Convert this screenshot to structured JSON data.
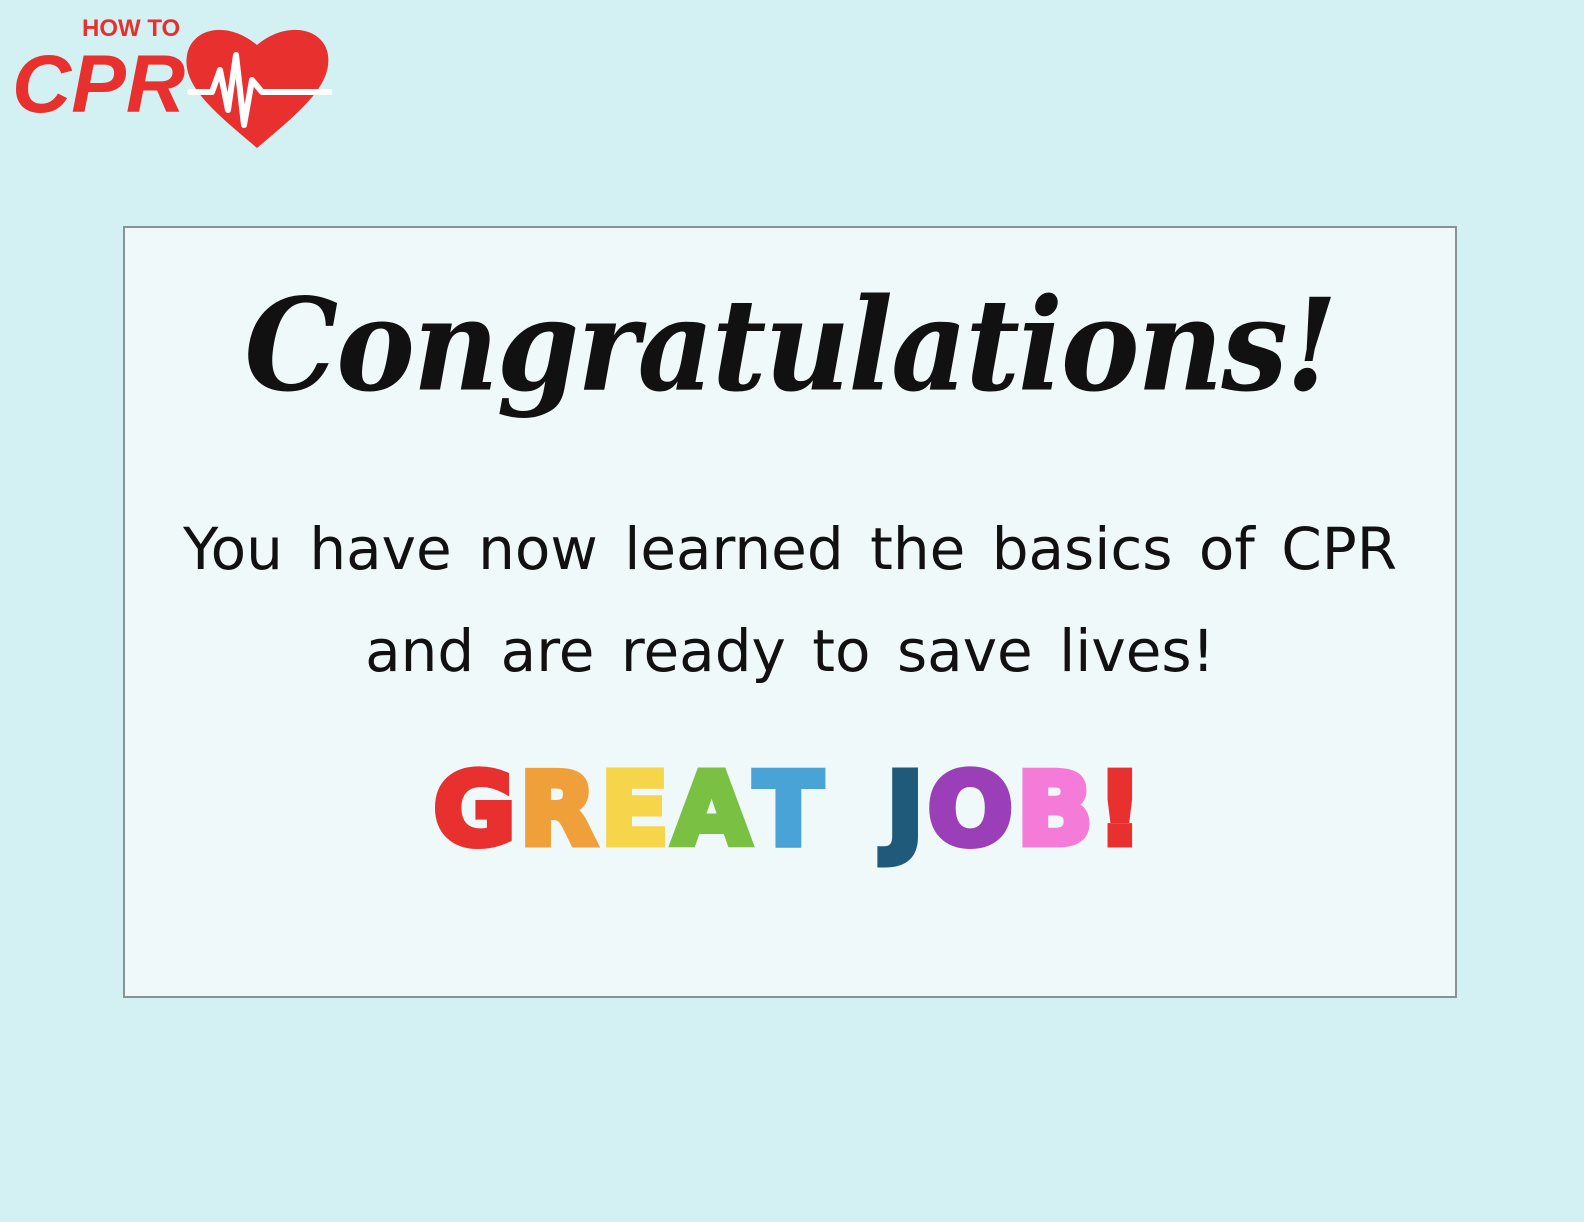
{
  "logo": {
    "small_text": "HOW TO",
    "big_text": "CPR",
    "icon": "heart-heartbeat-icon",
    "color": "#e8312f"
  },
  "card": {
    "heading": "Congratulations!",
    "message_line1": "You have now learned the basics of CPR",
    "message_line2": "and are ready to save lives!",
    "great_job": [
      {
        "char": "G",
        "color": "#e8312f"
      },
      {
        "char": "R",
        "color": "#f0a03a"
      },
      {
        "char": "E",
        "color": "#f7d54a"
      },
      {
        "char": "A",
        "color": "#7ac143"
      },
      {
        "char": "T",
        "color": "#4aa3d6"
      },
      {
        "char": " ",
        "color": ""
      },
      {
        "char": "J",
        "color": "#1f5a7a"
      },
      {
        "char": "O",
        "color": "#9b3fb8"
      },
      {
        "char": "B",
        "color": "#f47bd8"
      },
      {
        "char": "!",
        "color": "#e8312f"
      }
    ]
  }
}
